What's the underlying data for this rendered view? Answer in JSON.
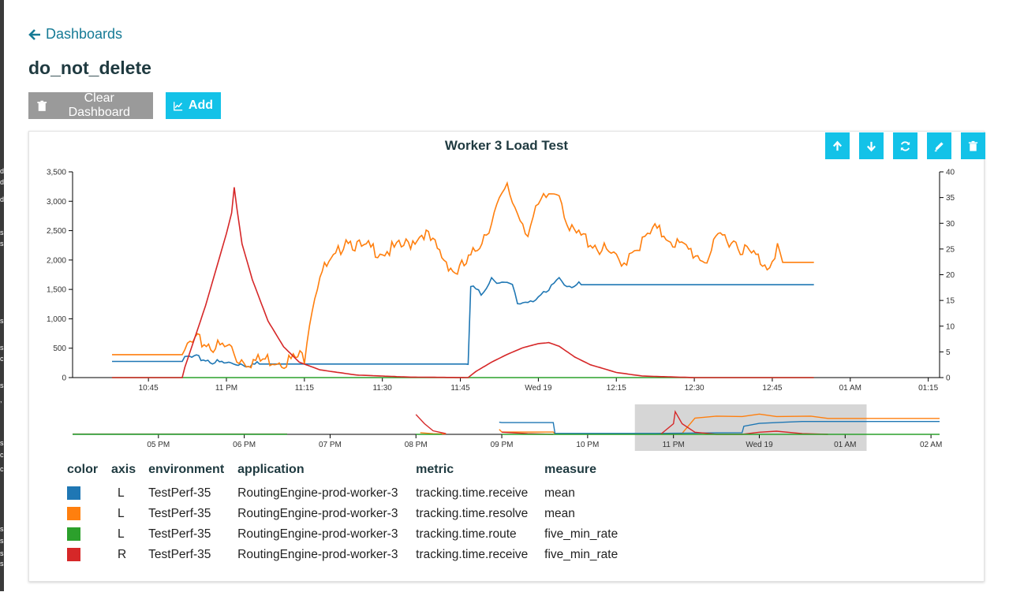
{
  "back_link": {
    "label": "Dashboards",
    "icon": "arrow-left-icon"
  },
  "page_title": "do_not_delete",
  "buttons": {
    "clear": {
      "label": "Clear Dashboard",
      "icon": "trash-icon"
    },
    "add": {
      "label": "Add",
      "icon": "line-chart-icon"
    }
  },
  "panel_toolbar": [
    {
      "name": "move-up",
      "icon": "arrow-up-icon"
    },
    {
      "name": "move-down",
      "icon": "arrow-down-icon"
    },
    {
      "name": "refresh",
      "icon": "refresh-icon"
    },
    {
      "name": "edit",
      "icon": "pencil-icon"
    },
    {
      "name": "delete",
      "icon": "trash-icon"
    }
  ],
  "left_strip_glyphs": [
    "d",
    "d",
    "d",
    "s",
    "s",
    "s",
    "s",
    "c",
    "s",
    ",",
    "s",
    "c",
    "c",
    "s",
    "s",
    "s",
    "s"
  ],
  "colors": {
    "blue": "#1f77b4",
    "orange": "#ff7f0e",
    "green": "#2ca02c",
    "red": "#d62728",
    "accent": "#13c2e8",
    "link": "#157a95"
  },
  "legend": {
    "headers": [
      "color",
      "axis",
      "environment",
      "application",
      "metric",
      "measure"
    ],
    "rows": [
      {
        "color": "#1f77b4",
        "axis": "L",
        "environment": "TestPerf-35",
        "application": "RoutingEngine-prod-worker-3",
        "metric": "tracking.time.receive",
        "measure": "mean"
      },
      {
        "color": "#ff7f0e",
        "axis": "L",
        "environment": "TestPerf-35",
        "application": "RoutingEngine-prod-worker-3",
        "metric": "tracking.time.resolve",
        "measure": "mean"
      },
      {
        "color": "#2ca02c",
        "axis": "L",
        "environment": "TestPerf-35",
        "application": "RoutingEngine-prod-worker-3",
        "metric": "tracking.time.route",
        "measure": "five_min_rate"
      },
      {
        "color": "#d62728",
        "axis": "R",
        "environment": "TestPerf-35",
        "application": "RoutingEngine-prod-worker-3",
        "metric": "tracking.time.receive",
        "measure": "five_min_rate"
      }
    ]
  },
  "chart_data": {
    "type": "line",
    "title": "Worker 3 Load Test",
    "ylim_left": [
      0,
      3500
    ],
    "ylim_right": [
      0,
      40
    ],
    "y_ticks_left": [
      "0",
      "500",
      "1,000",
      "1,500",
      "2,000",
      "2,500",
      "3,000",
      "3,500"
    ],
    "y_ticks_right": [
      "0",
      "5",
      "10",
      "15",
      "20",
      "25",
      "30",
      "35",
      "40"
    ],
    "xlim_minutes": [
      -22,
      113
    ],
    "x_ticks": [
      {
        "label": "10:45",
        "t": -15
      },
      {
        "label": "11 PM",
        "t": 0
      },
      {
        "label": "11:15",
        "t": 15
      },
      {
        "label": "11:30",
        "t": 30
      },
      {
        "label": "11:45",
        "t": 45
      },
      {
        "label": "Wed 19",
        "t": 60
      },
      {
        "label": "12:15",
        "t": 75
      },
      {
        "label": "12:30",
        "t": 90
      },
      {
        "label": "12:45",
        "t": 105
      },
      {
        "label": "01 AM",
        "t": 120
      },
      {
        "label": "01:15",
        "t": 135
      }
    ],
    "series": [
      {
        "name": "tracking.time.receive mean",
        "color": "#1f77b4",
        "axis": "L",
        "points": [
          [
            -22,
            275
          ],
          [
            -8.5,
            275
          ],
          [
            -8,
            360
          ],
          [
            -4,
            300
          ],
          [
            0,
            240
          ],
          [
            5,
            230
          ],
          [
            15,
            230
          ],
          [
            40,
            230
          ],
          [
            46.5,
            230
          ],
          [
            47,
            1550
          ],
          [
            49,
            1400
          ],
          [
            51,
            1700
          ],
          [
            53,
            1620
          ],
          [
            55,
            1550
          ],
          [
            56,
            1250
          ],
          [
            58,
            1300
          ],
          [
            60,
            1380
          ],
          [
            62,
            1450
          ],
          [
            63,
            1600
          ],
          [
            64,
            1700
          ],
          [
            65,
            1600
          ],
          [
            66,
            1580
          ],
          [
            80,
            1580
          ],
          [
            113,
            1580
          ]
        ]
      },
      {
        "name": "tracking.time.resolve mean",
        "color": "#ff7f0e",
        "axis": "L",
        "points": [
          [
            -22,
            390
          ],
          [
            -8.5,
            390
          ],
          [
            -7.5,
            560
          ],
          [
            -6,
            600
          ],
          [
            -3,
            560
          ],
          [
            1,
            500
          ],
          [
            2,
            310
          ],
          [
            7,
            290
          ],
          [
            12,
            310
          ],
          [
            15,
            350
          ],
          [
            16,
            1000
          ],
          [
            18,
            1800
          ],
          [
            21,
            2000
          ],
          [
            23,
            2400
          ],
          [
            26,
            2200
          ],
          [
            30,
            2150
          ],
          [
            35,
            2250
          ],
          [
            38,
            2500
          ],
          [
            41,
            2100
          ],
          [
            44,
            1800
          ],
          [
            47,
            2000
          ],
          [
            50,
            2500
          ],
          [
            52,
            2900
          ],
          [
            54,
            3200
          ],
          [
            56,
            2800
          ],
          [
            58,
            2500
          ],
          [
            60,
            2900
          ],
          [
            62,
            3100
          ],
          [
            64,
            3200
          ],
          [
            66,
            2500
          ],
          [
            70,
            2300
          ],
          [
            74,
            2100
          ],
          [
            76,
            1850
          ],
          [
            78,
            2200
          ],
          [
            80,
            2300
          ],
          [
            82,
            2500
          ],
          [
            85,
            2400
          ],
          [
            88,
            2200
          ],
          [
            92,
            2000
          ],
          [
            95,
            2400
          ],
          [
            98,
            2300
          ],
          [
            101,
            2100
          ],
          [
            104,
            1900
          ],
          [
            106,
            2250
          ],
          [
            107,
            1960
          ],
          [
            113,
            1960
          ]
        ]
      },
      {
        "name": "tracking.time.route five_min_rate",
        "color": "#2ca02c",
        "axis": "L",
        "points": [
          [
            -22,
            0
          ],
          [
            113,
            0
          ]
        ]
      },
      {
        "name": "tracking.time.receive five_min_rate",
        "color": "#d62728",
        "axis": "R",
        "points": [
          [
            -22,
            0
          ],
          [
            -8.5,
            0
          ],
          [
            -8,
            2
          ],
          [
            -6,
            8
          ],
          [
            -4,
            14
          ],
          [
            -2,
            21
          ],
          [
            0,
            28
          ],
          [
            1,
            32
          ],
          [
            1.5,
            37
          ],
          [
            2,
            33
          ],
          [
            3,
            26
          ],
          [
            5,
            19
          ],
          [
            8,
            11
          ],
          [
            11,
            6
          ],
          [
            14,
            3
          ],
          [
            18,
            1.5
          ],
          [
            25,
            0.5
          ],
          [
            35,
            0.1
          ],
          [
            46.5,
            0
          ],
          [
            48,
            1.2
          ],
          [
            51,
            3
          ],
          [
            54,
            4.5
          ],
          [
            57,
            5.8
          ],
          [
            60,
            6.6
          ],
          [
            62,
            6.8
          ],
          [
            64,
            6.1
          ],
          [
            67,
            4
          ],
          [
            70,
            2.5
          ],
          [
            75,
            1
          ],
          [
            80,
            0.3
          ],
          [
            90,
            0
          ],
          [
            113,
            0
          ]
        ]
      }
    ],
    "overview": {
      "x_ticks": [
        "05 PM",
        "06 PM",
        "07 PM",
        "08 PM",
        "09 PM",
        "10 PM",
        "11 PM",
        "Wed 19",
        "01 AM",
        "02 AM"
      ],
      "x_ticks_hours": [
        17,
        18,
        19,
        20,
        21,
        22,
        23,
        24,
        25,
        26
      ],
      "xlim_hours": [
        16.0,
        26.1
      ],
      "selection_hours": [
        22.55,
        25.25
      ]
    }
  }
}
